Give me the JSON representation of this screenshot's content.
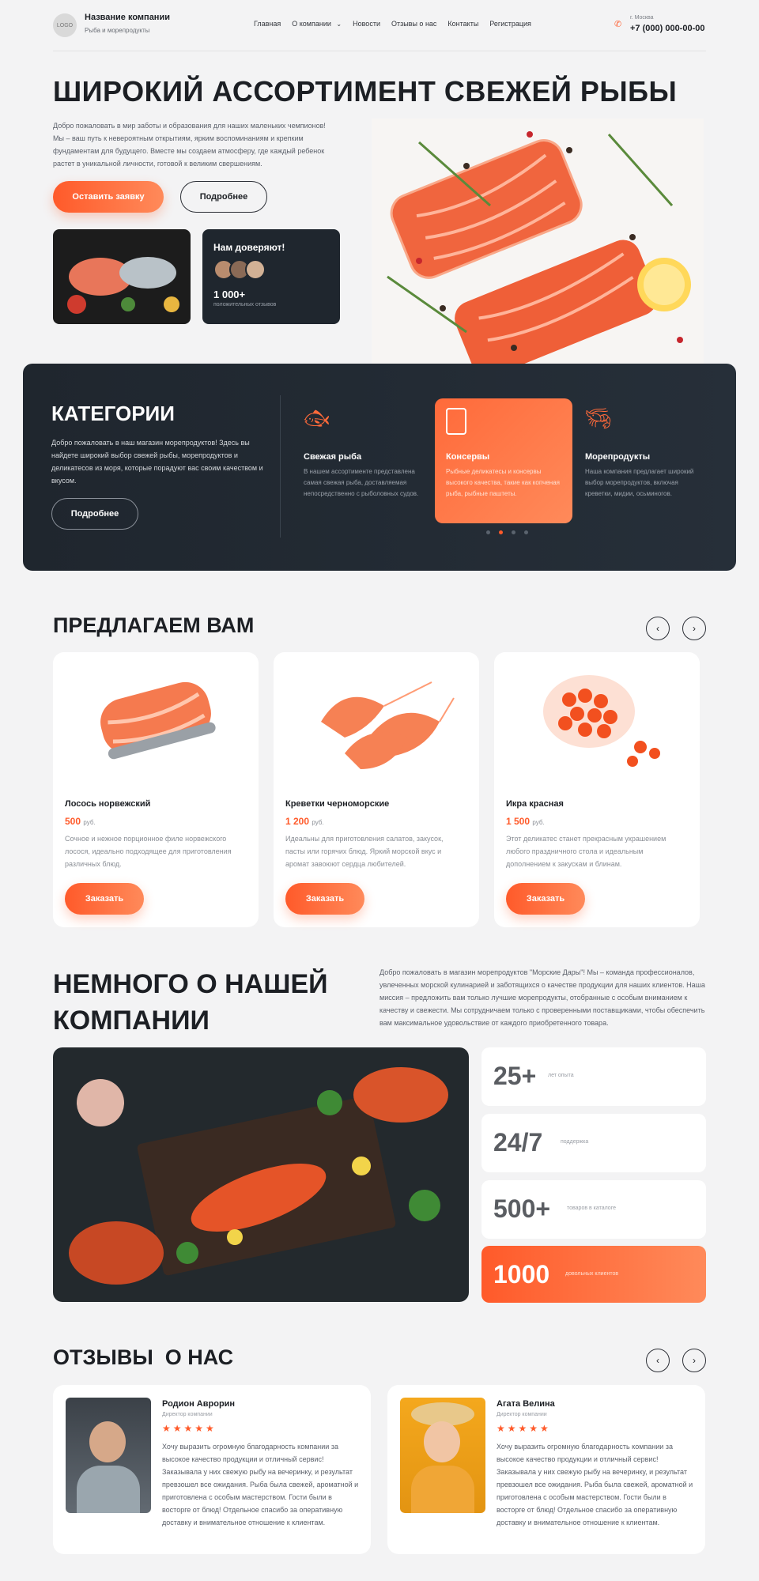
{
  "header": {
    "logo_text": "LOGO",
    "company_name": "Название компании",
    "company_sub": "Рыба и морепродукты",
    "nav": [
      "Главная",
      "О компании",
      "Новости",
      "Отзывы о нас",
      "Контакты",
      "Регистрация"
    ],
    "city": "г. Москва",
    "phone": "+7 (000) 000-00-00"
  },
  "hero": {
    "title": "ШИРОКИЙ АССОРТИМЕНТ СВЕЖЕЙ РЫБЫ",
    "text": "Добро пожаловать в мир заботы и образования для наших маленьких чемпионов! Мы – ваш путь к невероятным открытиям, ярким воспоминаниям и крепким фундаментам для будущего. Вместе мы создаем атмосферу, где каждый ребенок растет в уникальной личности, готовой к великим свершениям.",
    "primary_btn": "Оставить заявку",
    "secondary_btn": "Подробнее",
    "trust_title": "Нам доверяют!",
    "trust_count": "1 000+",
    "trust_sub": "положительных отзывов"
  },
  "categories": {
    "title": "КАТЕГОРИИ",
    "text": "Добро пожаловать в наш магазин морепродуктов! Здесь вы найдете широкий выбор свежей рыбы, морепродуктов и деликатесов из моря, которые порадуют вас своим качеством и вкусом.",
    "btn": "Подробнее",
    "items": [
      {
        "title": "Свежая рыба",
        "text": "В нашем ассортименте представлена самая свежая рыба, доставляемая непосредственно с рыболовных судов."
      },
      {
        "title": "Консервы",
        "text": "Рыбные деликатесы и консервы высокого качества, такие как копченая рыба, рыбные паштеты."
      },
      {
        "title": "Морепродукты",
        "text": "Наша компания предлагает широкий выбор морепродуктов, включая креветки, мидии, осьминогов."
      }
    ]
  },
  "offers": {
    "title": "ПРЕДЛАГАЕМ ВАМ",
    "prev": "‹",
    "next": "›",
    "items": [
      {
        "name": "Лосось норвежский",
        "price": "500",
        "currency": "руб.",
        "text": "Сочное и нежное порционное филе норвежского лосося, идеально подходящее для приготовления различных блюд.",
        "btn": "Заказать"
      },
      {
        "name": "Креветки черноморские",
        "price": "1 200",
        "currency": "руб.",
        "text": "Идеальны для приготовления салатов, закусок, пасты или горячих блюд. Яркий морской вкус и аромат завоюют сердца любителей.",
        "btn": "Заказать"
      },
      {
        "name": "Икра красная",
        "price": "1 500",
        "currency": "руб.",
        "text": "Этот деликатес станет прекрасным украшением любого праздничного стола и идеальным дополнением к закускам и блинам.",
        "btn": "Заказать"
      }
    ]
  },
  "about": {
    "title": "НЕМНОГО О НАШЕЙ КОМПАНИИ",
    "text": "Добро пожаловать в магазин морепродуктов \"Морские Дары\"! Мы – команда профессионалов, увлеченных морской кулинарией и заботящихся о качестве продукции для наших клиентов. Наша миссия – предложить вам только лучшие морепродукты, отобранные с особым вниманием к качеству и свежести. Мы сотрудничаем только с проверенными поставщиками, чтобы обеспечить вам максимальное удовольствие от каждого приобретенного товара.",
    "stats": [
      {
        "value": "25+",
        "label": "лет опыта"
      },
      {
        "value": "24/7",
        "label": "поддержка"
      },
      {
        "value": "500+",
        "label": "товаров в каталоге"
      },
      {
        "value": "1000",
        "label": "довольных клиентов"
      }
    ]
  },
  "reviews": {
    "title": "ОТЗЫВЫ  О НАС",
    "prev": "‹",
    "next": "›",
    "items": [
      {
        "name": "Родион Аврорин",
        "role": "Директор компании",
        "stars": "★★★★★",
        "text": "Хочу выразить огромную благодарность компании за высокое качество продукции и отличный сервис! Заказывала у них свежую рыбу на вечеринку, и результат превзошел все ожидания. Рыба была свежей, ароматной и приготовлена с особым мастерством. Гости были в восторге от блюд! Отдельное спасибо за оперативную доставку и внимательное отношение к клиентам."
      },
      {
        "name": "Агата Велина",
        "role": "Директор компании",
        "stars": "★★★★★",
        "text": "Хочу выразить огромную благодарность компании за высокое качество продукции и отличный сервис! Заказывала у них свежую рыбу на вечеринку, и результат превзошел все ожидания. Рыба была свежей, ароматной и приготовлена с особым мастерством. Гости были в восторге от блюд! Отдельное спасибо за оперативную доставку и внимательное отношение к клиентам."
      }
    ]
  },
  "colors": {
    "accent": "#ff5a2a",
    "dark": "#1f262e",
    "bg": "#f3f3f4"
  }
}
